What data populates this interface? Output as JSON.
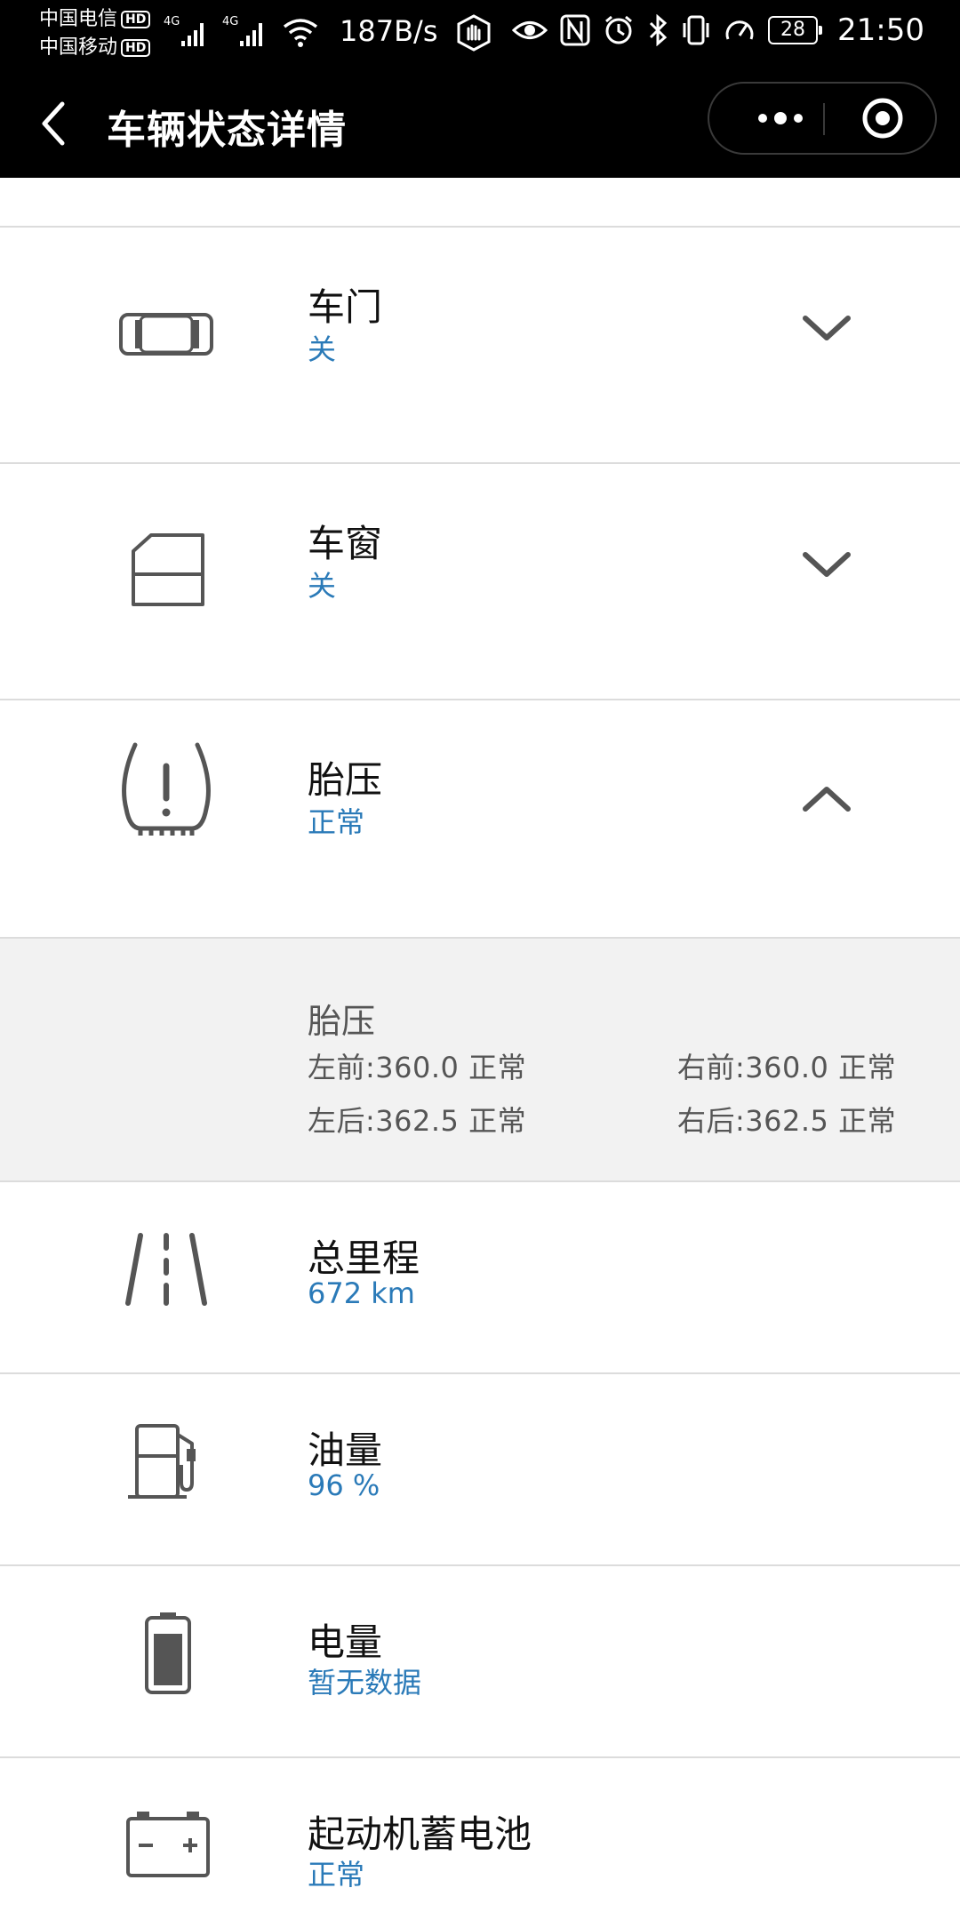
{
  "status_bar": {
    "carrier1": "中国电信",
    "carrier2": "中国移动",
    "hd_badge": "HD",
    "net1": "4G",
    "net2": "4G",
    "speed": "187B/s",
    "battery": "28",
    "time": "21:50"
  },
  "nav": {
    "title": "车辆状态详情"
  },
  "items": [
    {
      "label": "车门",
      "value": "关",
      "icon": "car-door-icon"
    },
    {
      "label": "车窗",
      "value": "关",
      "icon": "car-window-icon"
    },
    {
      "label": "胎压",
      "value": "正常",
      "icon": "tire-pressure-icon"
    },
    {
      "label": "总里程",
      "value": "672 km",
      "icon": "road-icon"
    },
    {
      "label": "油量",
      "value": "96 %",
      "icon": "fuel-icon"
    },
    {
      "label": "电量",
      "value": "暂无数据",
      "icon": "battery-icon"
    },
    {
      "label": "起动机蓄电池",
      "value": "正常",
      "icon": "car-battery-icon"
    }
  ],
  "tire_detail": {
    "title": "胎压",
    "front_left": "左前:360.0 正常",
    "front_right": "右前:360.0 正常",
    "rear_left": "左后:362.5 正常",
    "rear_right": "右后:362.5 正常"
  },
  "colors": {
    "accent": "#2a7ab8",
    "divider": "#dcdcdc",
    "detail_bg": "#f2f2f2",
    "icon": "#555555"
  }
}
